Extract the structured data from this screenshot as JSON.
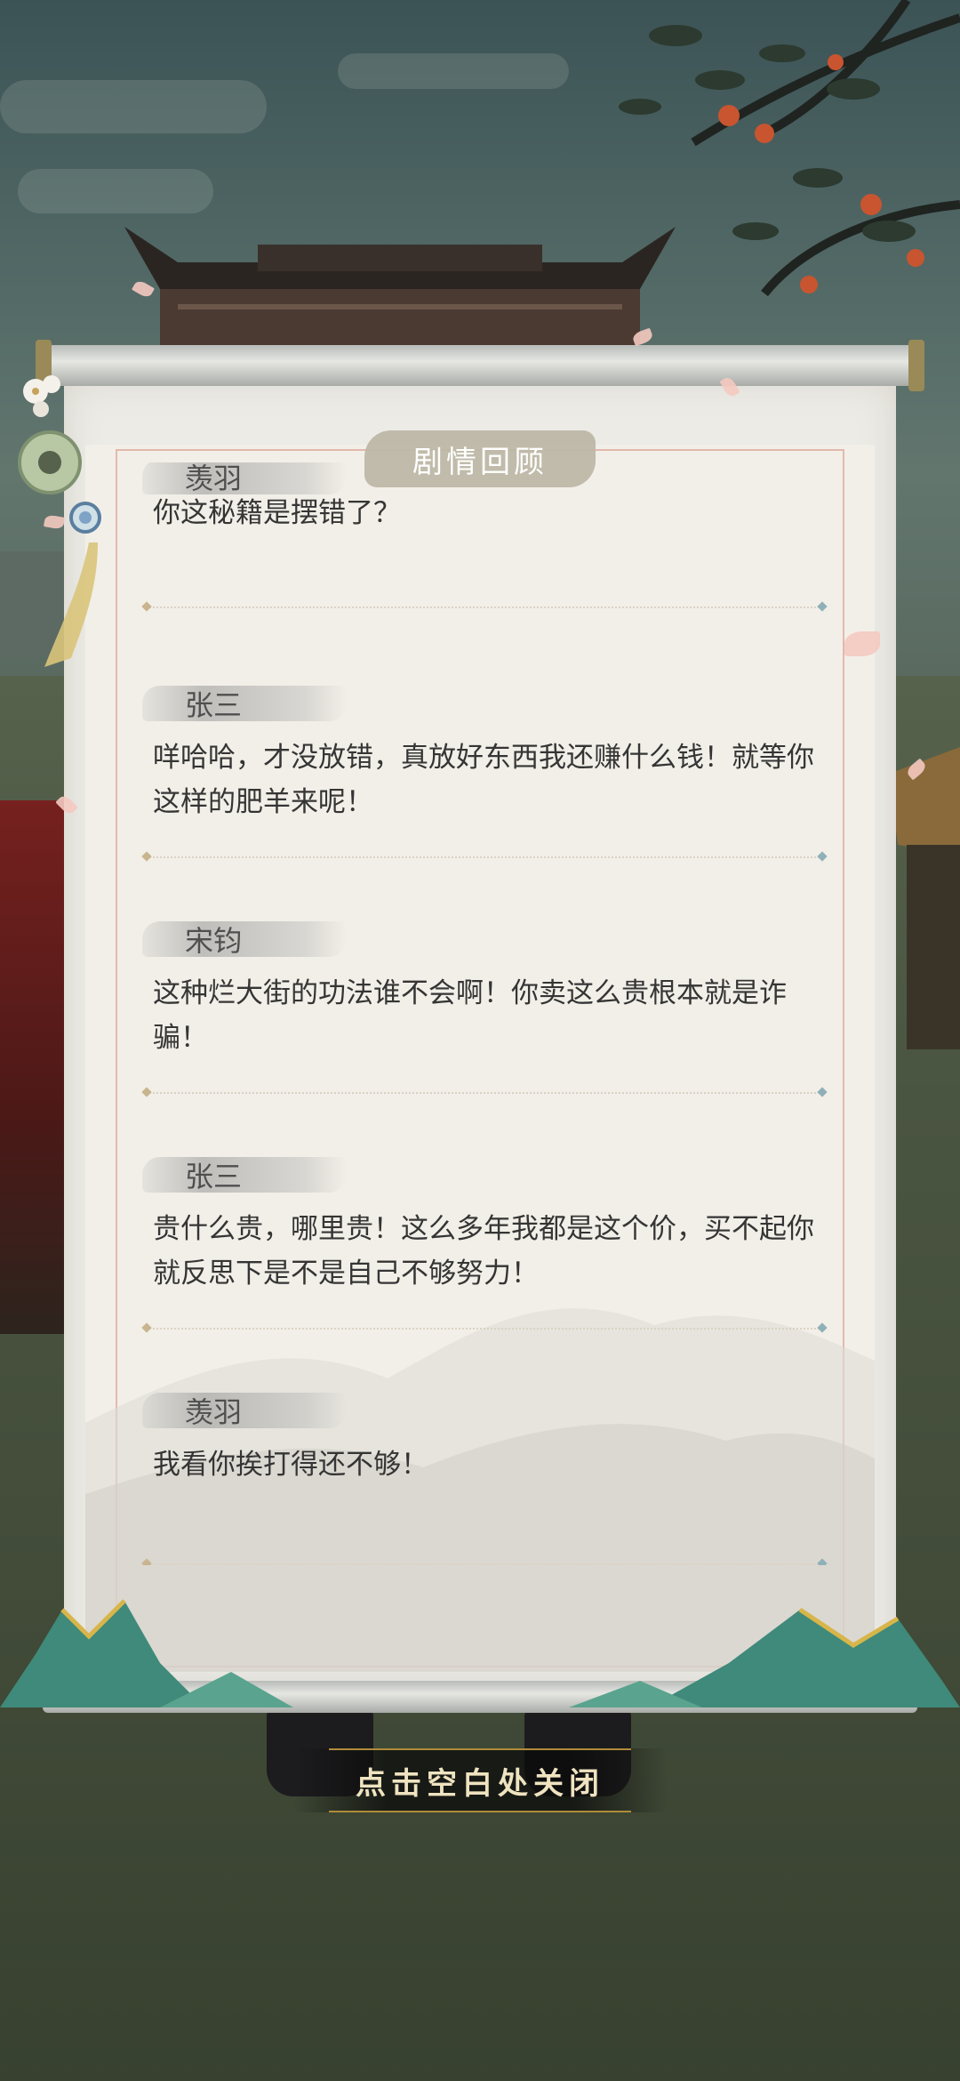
{
  "scene": {
    "colors": {
      "scroll_paper": "#ecebe6",
      "frame_border": "#e3b9ae",
      "title_bg": "#bdb7a6",
      "text": "#353535",
      "close_text": "#efe3c0"
    }
  },
  "panel": {
    "title": "剧情回顾",
    "partial_top_speaker": "羡羽",
    "partial_top_line": "你这秘籍是摆错了？",
    "entries": [
      {
        "speaker": "张三",
        "line": "咩哈哈，才没放错，真放好东西我还赚什么钱！就等你这样的肥羊来呢！"
      },
      {
        "speaker": "宋钧",
        "line": "这种烂大街的功法谁不会啊！你卖这么贵根本就是诈骗！"
      },
      {
        "speaker": "张三",
        "line": "贵什么贵，哪里贵！这么多年我都是这个价，买不起你就反思下是不是自己不够努力！"
      },
      {
        "speaker": "羡羽",
        "line": "我看你挨打得还不够！"
      }
    ]
  },
  "close_hint": {
    "label": "点击空白处关闭"
  },
  "icons": {
    "jade_pendant": "jade-disc-icon",
    "magnifier": "magnifier-charm-icon",
    "flower": "plum-blossom-icon"
  }
}
